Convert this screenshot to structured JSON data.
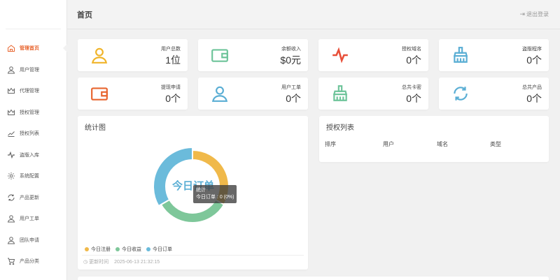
{
  "header": {
    "title": "首页",
    "logout_label": "退出登录"
  },
  "sidebar": {
    "items": [
      {
        "label": "管理首页",
        "icon": "home-icon",
        "active": true
      },
      {
        "label": "用户管理",
        "icon": "user-icon"
      },
      {
        "label": "代理管理",
        "icon": "crown-icon"
      },
      {
        "label": "授权管理",
        "icon": "crown-icon"
      },
      {
        "label": "授权列表",
        "icon": "trend-icon"
      },
      {
        "label": "盗版入库",
        "icon": "pulse-icon"
      },
      {
        "label": "系统配置",
        "icon": "gear-icon"
      },
      {
        "label": "产品更新",
        "icon": "refresh-icon"
      },
      {
        "label": "用户工单",
        "icon": "user-icon"
      },
      {
        "label": "团队申请",
        "icon": "user-icon"
      },
      {
        "label": "产品分类",
        "icon": "cart-icon"
      }
    ]
  },
  "stats": [
    {
      "label": "用户总数",
      "value": "1位",
      "icon": "user-icon",
      "color": "#f0b429"
    },
    {
      "label": "余额收入",
      "value": "$0元",
      "icon": "wallet-icon",
      "color": "#6ec49a"
    },
    {
      "label": "授权域名",
      "value": "0个",
      "icon": "pulse-icon",
      "color": "#e8503a"
    },
    {
      "label": "盗版程序",
      "value": "0个",
      "icon": "broom-icon",
      "color": "#5aaed4"
    },
    {
      "label": "提现申请",
      "value": "0个",
      "icon": "wallet-icon",
      "color": "#e8652f"
    },
    {
      "label": "用户工单",
      "value": "0个",
      "icon": "user-icon",
      "color": "#5aaed4"
    },
    {
      "label": "总共卡密",
      "value": "0个",
      "icon": "broom-icon",
      "color": "#6ec49a"
    },
    {
      "label": "总共产品",
      "value": "0个",
      "icon": "refresh-icon",
      "color": "#5aaed4"
    }
  ],
  "chart_panel": {
    "title": "统计图",
    "center_label": "今日订单",
    "tooltip_title": "统计",
    "tooltip_text": "今日订单 : 0 (0%)",
    "updated_label": "更新时间",
    "updated_time": "2025-06-13 21:32:15"
  },
  "chart_data": {
    "type": "pie",
    "title": "统计图",
    "categories": [
      "今日注册",
      "今日收益",
      "今日订单"
    ],
    "values": [
      1,
      1,
      1
    ],
    "colors": [
      "#f0b94a",
      "#7ec79a",
      "#6bbbdb"
    ],
    "legend": "bottom-left"
  },
  "list_panel": {
    "title": "授权列表",
    "columns": [
      "排序",
      "用户",
      "域名",
      "类型"
    ]
  }
}
